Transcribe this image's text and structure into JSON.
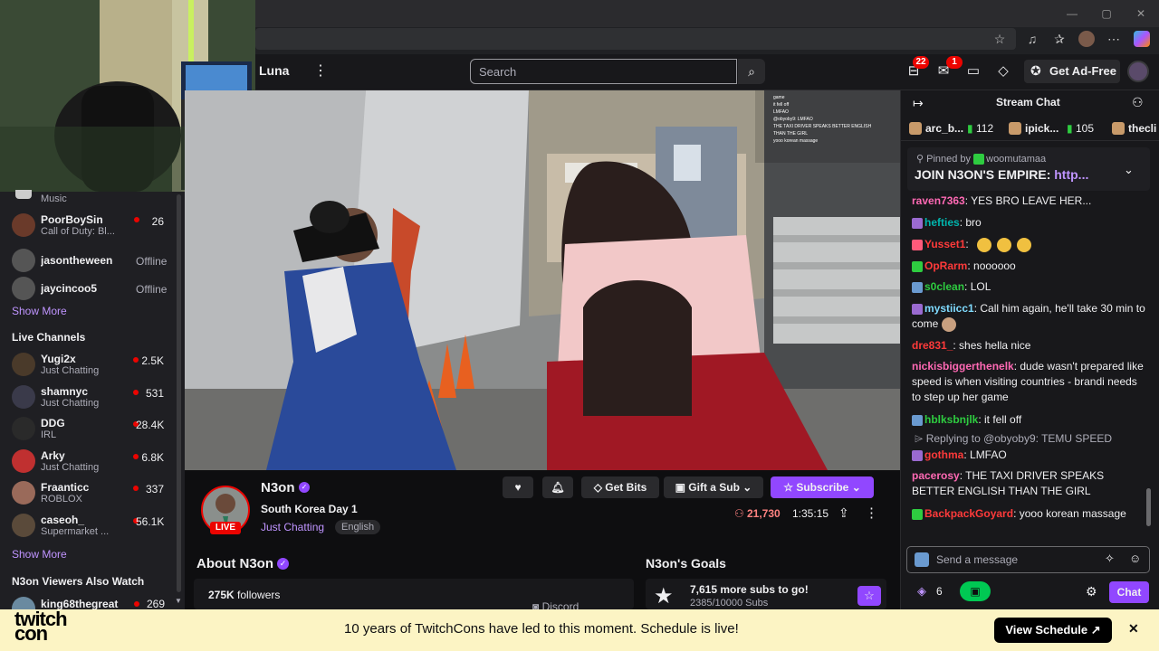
{
  "browser": {
    "window_controls": [
      "—",
      "▢",
      "✕"
    ]
  },
  "nav": {
    "brand": "Luna",
    "search_placeholder": "Search",
    "notif_count": "22",
    "inbox_count": "1",
    "ad_free": "Get Ad-Free"
  },
  "sidebar": {
    "top_item": {
      "sub": "Music"
    },
    "followed": [
      {
        "name": "PoorBoySin",
        "sub": "Call of Duty: Bl...",
        "count": "26",
        "live": true,
        "color": "#6a3a2a"
      },
      {
        "name": "jasontheween",
        "sub": "",
        "count": "Offline",
        "live": false,
        "color": "#555"
      },
      {
        "name": "jaycincoo5",
        "sub": "",
        "count": "Offline",
        "live": false,
        "color": "#555"
      }
    ],
    "show_more_1": "Show More",
    "live_channels_heading": "Live Channels",
    "live": [
      {
        "name": "Yugi2x",
        "sub": "Just Chatting",
        "count": "2.5K",
        "color": "#4a3a2a"
      },
      {
        "name": "shamnyc",
        "sub": "Just Chatting",
        "count": "531",
        "color": "#3a3a4a"
      },
      {
        "name": "DDG",
        "sub": "IRL",
        "count": "28.4K",
        "color": "#2a2a2a"
      },
      {
        "name": "Arky",
        "sub": "Just Chatting",
        "count": "6.8K",
        "color": "#c03030"
      },
      {
        "name": "Fraanticc",
        "sub": "ROBLOX",
        "count": "337",
        "color": "#9a6a5a"
      },
      {
        "name": "caseoh_",
        "sub": "Supermarket ...",
        "count": "56.1K",
        "color": "#5a4a3a"
      }
    ],
    "show_more_2": "Show More",
    "also_watch_heading": "N3on Viewers Also Watch",
    "also_watch": [
      {
        "name": "king68thegreat",
        "count": "269"
      }
    ]
  },
  "stream": {
    "channel": "N3on",
    "live": "LIVE",
    "title": "South Korea Day 1",
    "category": "Just Chatting",
    "tag": "English",
    "viewers": "21,730",
    "uptime": "1:35:15",
    "get_bits": "Get Bits",
    "gift_sub": "Gift a Sub",
    "subscribe": "Subscribe",
    "overlay_chat": [
      "game",
      "it fell off",
      "LMFAO",
      "@obyoby9: LMFAO",
      "THE TAXI DRIVER SPEAKS BETTER ENGLISH",
      "THAN THE GIRL",
      "yooo korean massage"
    ]
  },
  "about": {
    "title": "About N3on",
    "followers_count": "275K",
    "followers_label": "followers",
    "discord": "Discord"
  },
  "goals": {
    "title": "N3on's Goals",
    "headline": "7,615 more subs to go!",
    "progress_text": "2385/10000 Subs",
    "progress": 0.2385
  },
  "chat": {
    "title": "Stream Chat",
    "gifters": [
      {
        "name": "arc_b...",
        "count": "112"
      },
      {
        "name": "ipick...",
        "count": "105"
      },
      {
        "name": "thecli",
        "count": ""
      }
    ],
    "pinned_by_label": "Pinned by",
    "pinned_by": "woomutamaa",
    "pinned_text": "JOIN N3ON'S EMPIRE: ",
    "pinned_link": "http...",
    "messages": [
      {
        "name": "raven7363",
        "color": "#ff69b4",
        "text": "YES BRO LEAVE HER..."
      },
      {
        "name": "hefties",
        "color": "#00b5ad",
        "text": "bro"
      },
      {
        "name": "Yusset1",
        "color": "#ff3a3a",
        "text": ""
      },
      {
        "name": "OpRarm",
        "color": "#ff3a3a",
        "text": "noooooo"
      },
      {
        "name": "s0clean",
        "color": "#2ecc40",
        "text": "LOL"
      },
      {
        "name": "mystiicc1",
        "color": "#7fdbff",
        "text": "Call him again, he'll take 30 min to come"
      },
      {
        "name": "dre831_",
        "color": "#ff3a3a",
        "text": "shes hella nice"
      },
      {
        "name": "nickisbiggerthenelk",
        "color": "#ff69b4",
        "text": "dude wasn't prepared like speed is when visiting countries - brandi needs to step up her game"
      },
      {
        "name": "hblksbnjlk",
        "color": "#2ecc40",
        "text": "it fell off"
      },
      {
        "name": "gothma",
        "color": "#ff3a3a",
        "text": "LMFAO"
      },
      {
        "name": "pacerosy",
        "color": "#ff69b4",
        "text": "THE TAXI DRIVER SPEAKS BETTER ENGLISH THAN THE GIRL"
      },
      {
        "name": "BackpackGoyard",
        "color": "#ff3a3a",
        "text": "yooo korean massage"
      }
    ],
    "reply_text": "Replying to @obyoby9: TEMU SPEED",
    "input_placeholder": "Send a message",
    "points": "6",
    "chat_button": "Chat"
  },
  "banner": {
    "logo_line1": "twitch",
    "logo_line2": "con",
    "text": "10 years of TwitchCons have led to this moment. Schedule is live!",
    "button": "View Schedule ↗"
  }
}
